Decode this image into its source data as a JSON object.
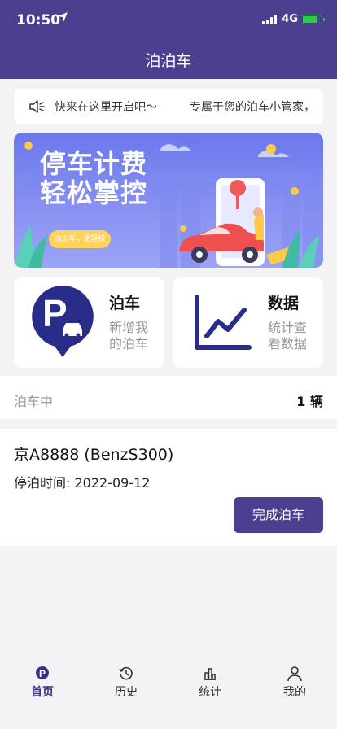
{
  "status": {
    "time": "10:50",
    "network": "4G"
  },
  "nav": {
    "title": "泊泊车"
  },
  "notice": {
    "text": "快来在这里开启吧～",
    "text2": "专属于您的泊车小管家，"
  },
  "banner": {
    "title_line1": "停车计费",
    "title_line2": "轻松掌控",
    "pill": "泊泊车，更轻松"
  },
  "cards": [
    {
      "title": "泊车",
      "subtitle": "新增我的泊车",
      "icon": "parking-icon"
    },
    {
      "title": "数据",
      "subtitle": "统计查看数据",
      "icon": "chart-icon"
    }
  ],
  "parking": {
    "label": "泊车中",
    "count": "1 辆"
  },
  "car": {
    "plate": "京A8888 (BenzS300)",
    "time": "停泊时间: 2022-09-12",
    "button": "完成泊车"
  },
  "tabs": [
    {
      "label": "首页",
      "icon": "home-parking-icon"
    },
    {
      "label": "历史",
      "icon": "history-icon"
    },
    {
      "label": "统计",
      "icon": "stats-icon"
    },
    {
      "label": "我的",
      "icon": "user-icon"
    }
  ],
  "colors": {
    "primary": "#4b3f8f",
    "background": "#f3f3f5",
    "banner": "#7a84ef",
    "pill": "#ffd35a"
  }
}
